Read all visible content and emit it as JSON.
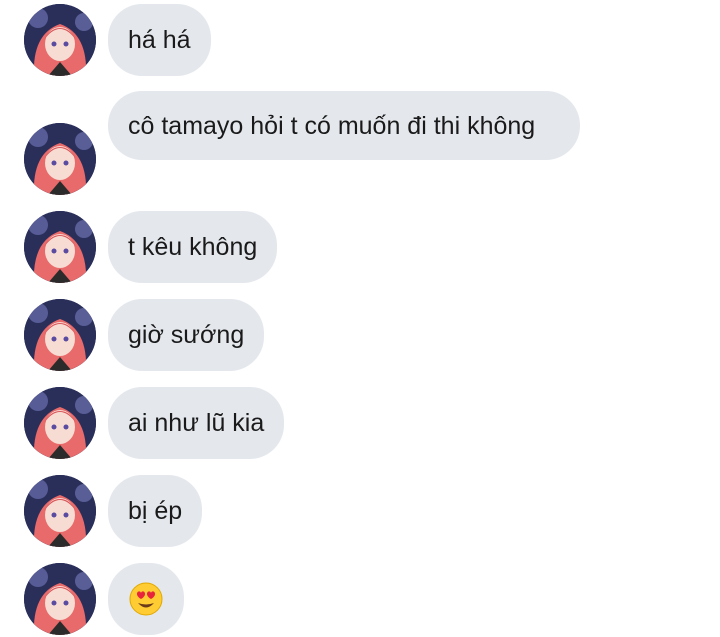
{
  "messages": [
    {
      "text": "há há",
      "type": "text"
    },
    {
      "text": "cô tamayo hỏi t có muốn đi thi không",
      "type": "text"
    },
    {
      "text": "t kêu không",
      "type": "text"
    },
    {
      "text": "giờ sướng",
      "type": "text"
    },
    {
      "text": "ai như lũ kia",
      "type": "text"
    },
    {
      "text": "bị ép",
      "type": "text"
    },
    {
      "text": "",
      "type": "emoji",
      "icon": "heart-eyes-emoji-icon"
    }
  ],
  "colors": {
    "bubble_bg": "#e4e8ed",
    "text": "#1a1a1a",
    "avatar_bg": "#2a2f5a",
    "hair": "#e86a6a"
  }
}
